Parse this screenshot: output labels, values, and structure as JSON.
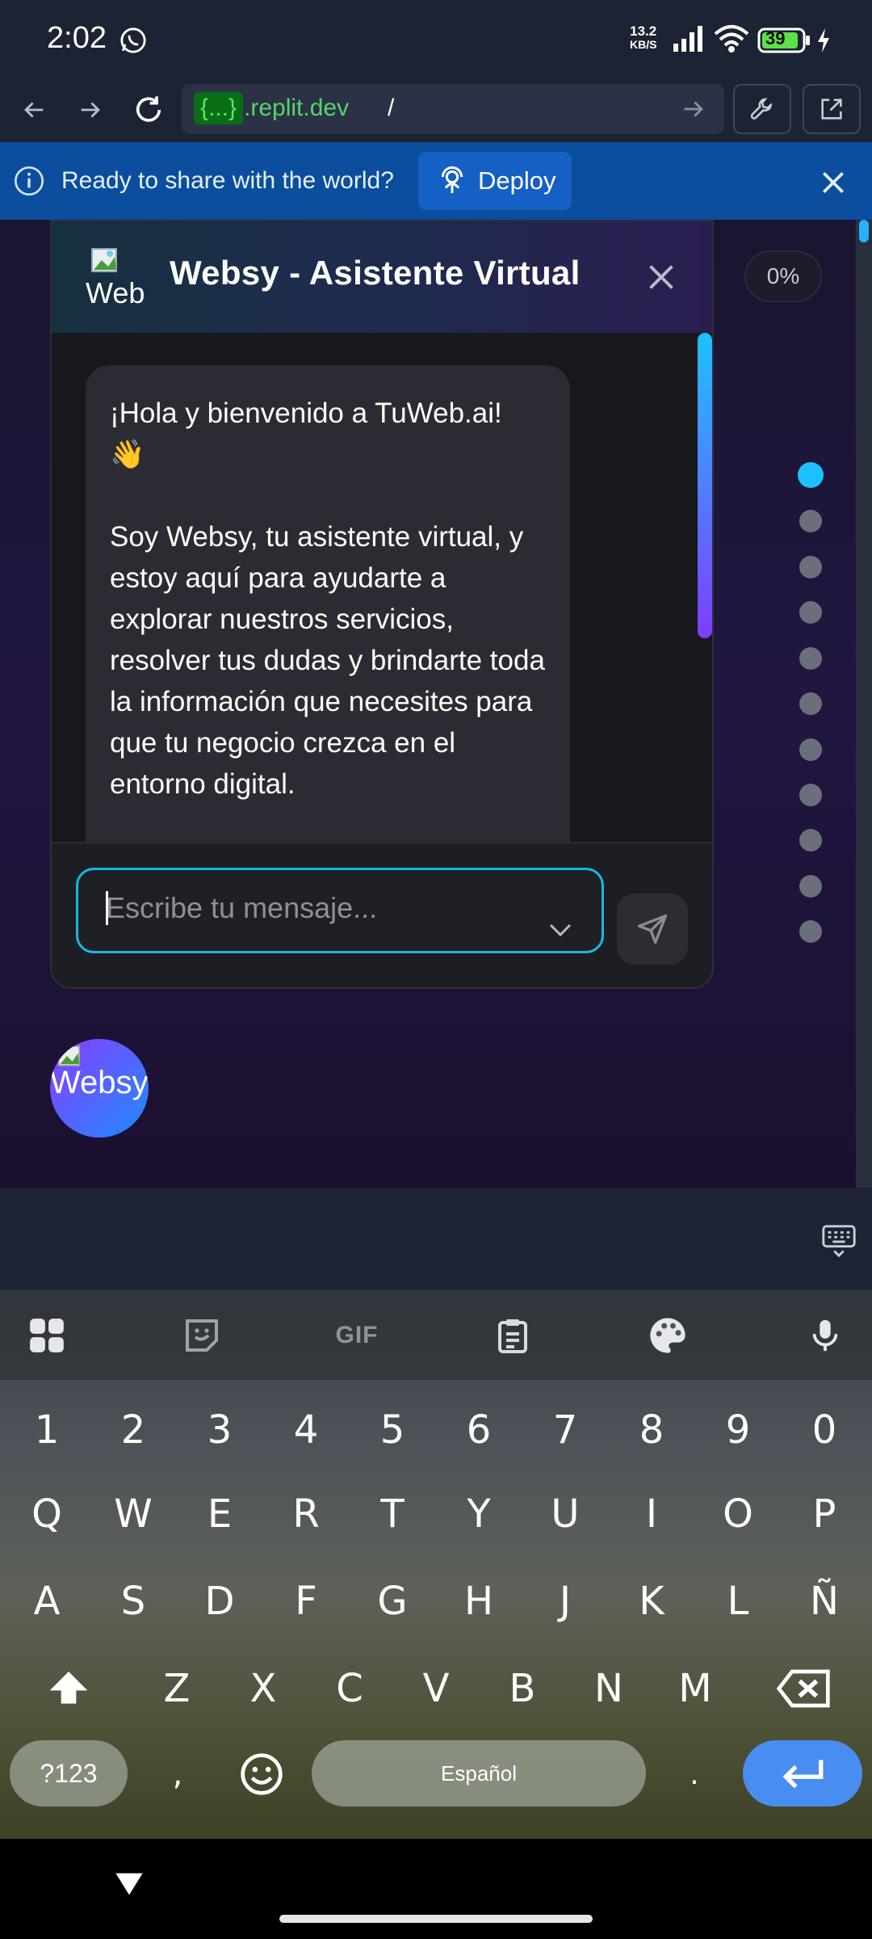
{
  "status_bar": {
    "time": "2:02",
    "net_speed_value": "13.2",
    "net_speed_unit": "KB/S",
    "battery": "39"
  },
  "browser": {
    "url_prefix": "{...}",
    "url_domain": ".replit.dev",
    "url_path": "/"
  },
  "banner": {
    "text": "Ready to share with the world?",
    "deploy_label": "Deploy"
  },
  "page": {
    "progress_label": "0%",
    "section_dots": 11,
    "active_dot": 0
  },
  "chat": {
    "logo_alt": "Web",
    "title": "Websy - Asistente Virtual",
    "message": "¡Hola y bienvenido a TuWeb.ai!\n👋\n\nSoy Websy, tu asistente virtual, y estoy aquí para ayudarte a explorar nuestros servicios, resolver tus dudas y brindarte toda la información que necesites para que tu negocio crezca en el entorno digital.",
    "input_placeholder": "Escribe tu mensaje...",
    "bubble_label": "Websy"
  },
  "keyboard": {
    "toolbar": [
      "apps-grid-icon",
      "sticker-icon",
      "gif-icon",
      "clipboard-icon",
      "palette-icon",
      "microphone-icon"
    ],
    "gif_label": "GIF",
    "row_numbers": [
      "1",
      "2",
      "3",
      "4",
      "5",
      "6",
      "7",
      "8",
      "9",
      "0"
    ],
    "row_1": [
      "Q",
      "W",
      "E",
      "R",
      "T",
      "Y",
      "U",
      "I",
      "O",
      "P"
    ],
    "row_2": [
      "A",
      "S",
      "D",
      "F",
      "G",
      "H",
      "J",
      "K",
      "L",
      "Ñ"
    ],
    "row_3": [
      "Z",
      "X",
      "C",
      "V",
      "B",
      "N",
      "M"
    ],
    "symbols_label": "?123",
    "comma": ",",
    "space_label": "Español",
    "period": "."
  },
  "colors": {
    "accent": "#1ec1ff",
    "banner": "#0b4e9e",
    "deploy_button": "#1560c4",
    "enter_key": "#4a8df0"
  }
}
